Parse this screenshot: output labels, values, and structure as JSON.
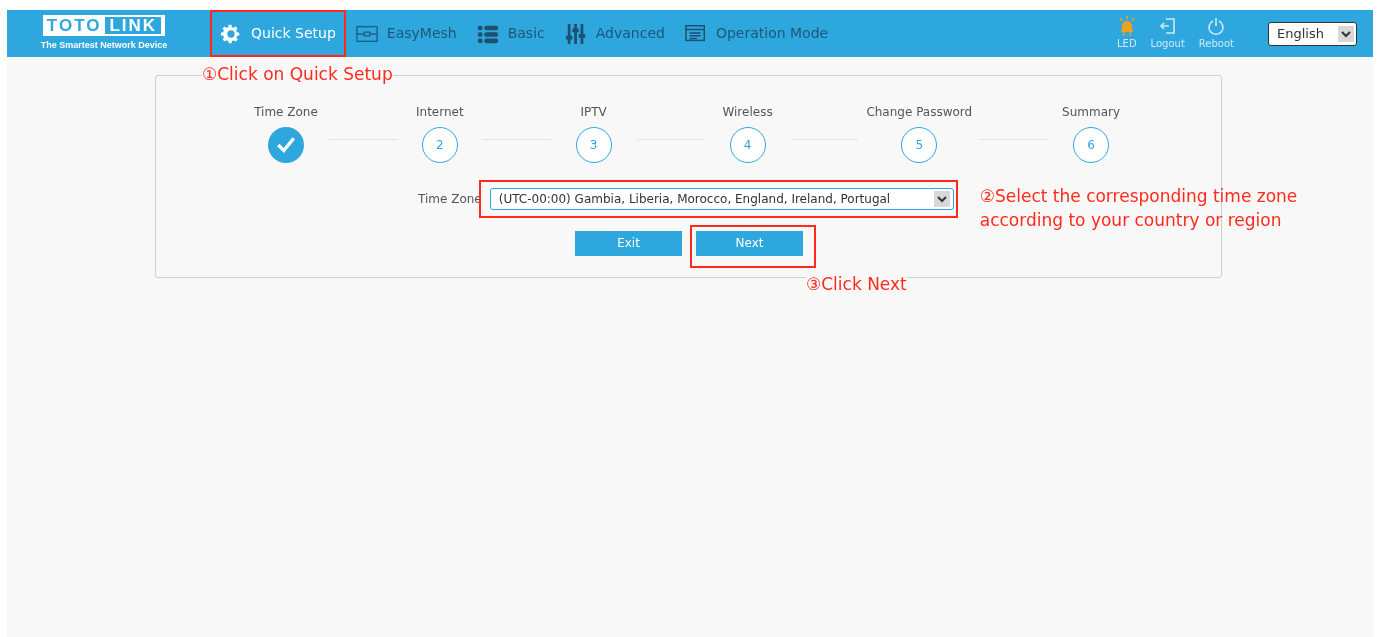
{
  "logo": {
    "brand_left": "TOTO",
    "brand_right": "LINK",
    "tagline": "The Smartest Network Device"
  },
  "nav": [
    {
      "label": "Quick Setup",
      "kind": "gear",
      "selected": true
    },
    {
      "label": "EasyMesh",
      "kind": "mesh",
      "selected": false
    },
    {
      "label": "Basic",
      "kind": "list",
      "selected": false
    },
    {
      "label": "Advanced",
      "kind": "sliders",
      "selected": false
    },
    {
      "label": "Operation Mode",
      "kind": "mode",
      "selected": false
    }
  ],
  "tools": [
    {
      "label": "LED",
      "kind": "led"
    },
    {
      "label": "Logout",
      "kind": "logout"
    },
    {
      "label": "Reboot",
      "kind": "power"
    }
  ],
  "language": {
    "value": "English"
  },
  "steps": [
    {
      "label": "Time Zone",
      "completed": true
    },
    {
      "label": "Internet",
      "number": "2",
      "completed": false
    },
    {
      "label": "IPTV",
      "number": "3",
      "completed": false
    },
    {
      "label": "Wireless",
      "number": "4",
      "completed": false
    },
    {
      "label": "Change Password",
      "number": "5",
      "completed": false
    },
    {
      "label": "Summary",
      "number": "6",
      "completed": false
    }
  ],
  "time_zone": {
    "label": "Time Zone",
    "value": "(UTC-00:00) Gambia, Liberia, Morocco, England, Ireland, Portugal"
  },
  "buttons": [
    {
      "label": "Exit"
    },
    {
      "label": "Next"
    }
  ],
  "annotations": [
    "①Click on Quick Setup",
    "②Select the corresponding time zone according to your country or region",
    "③Click Next"
  ]
}
